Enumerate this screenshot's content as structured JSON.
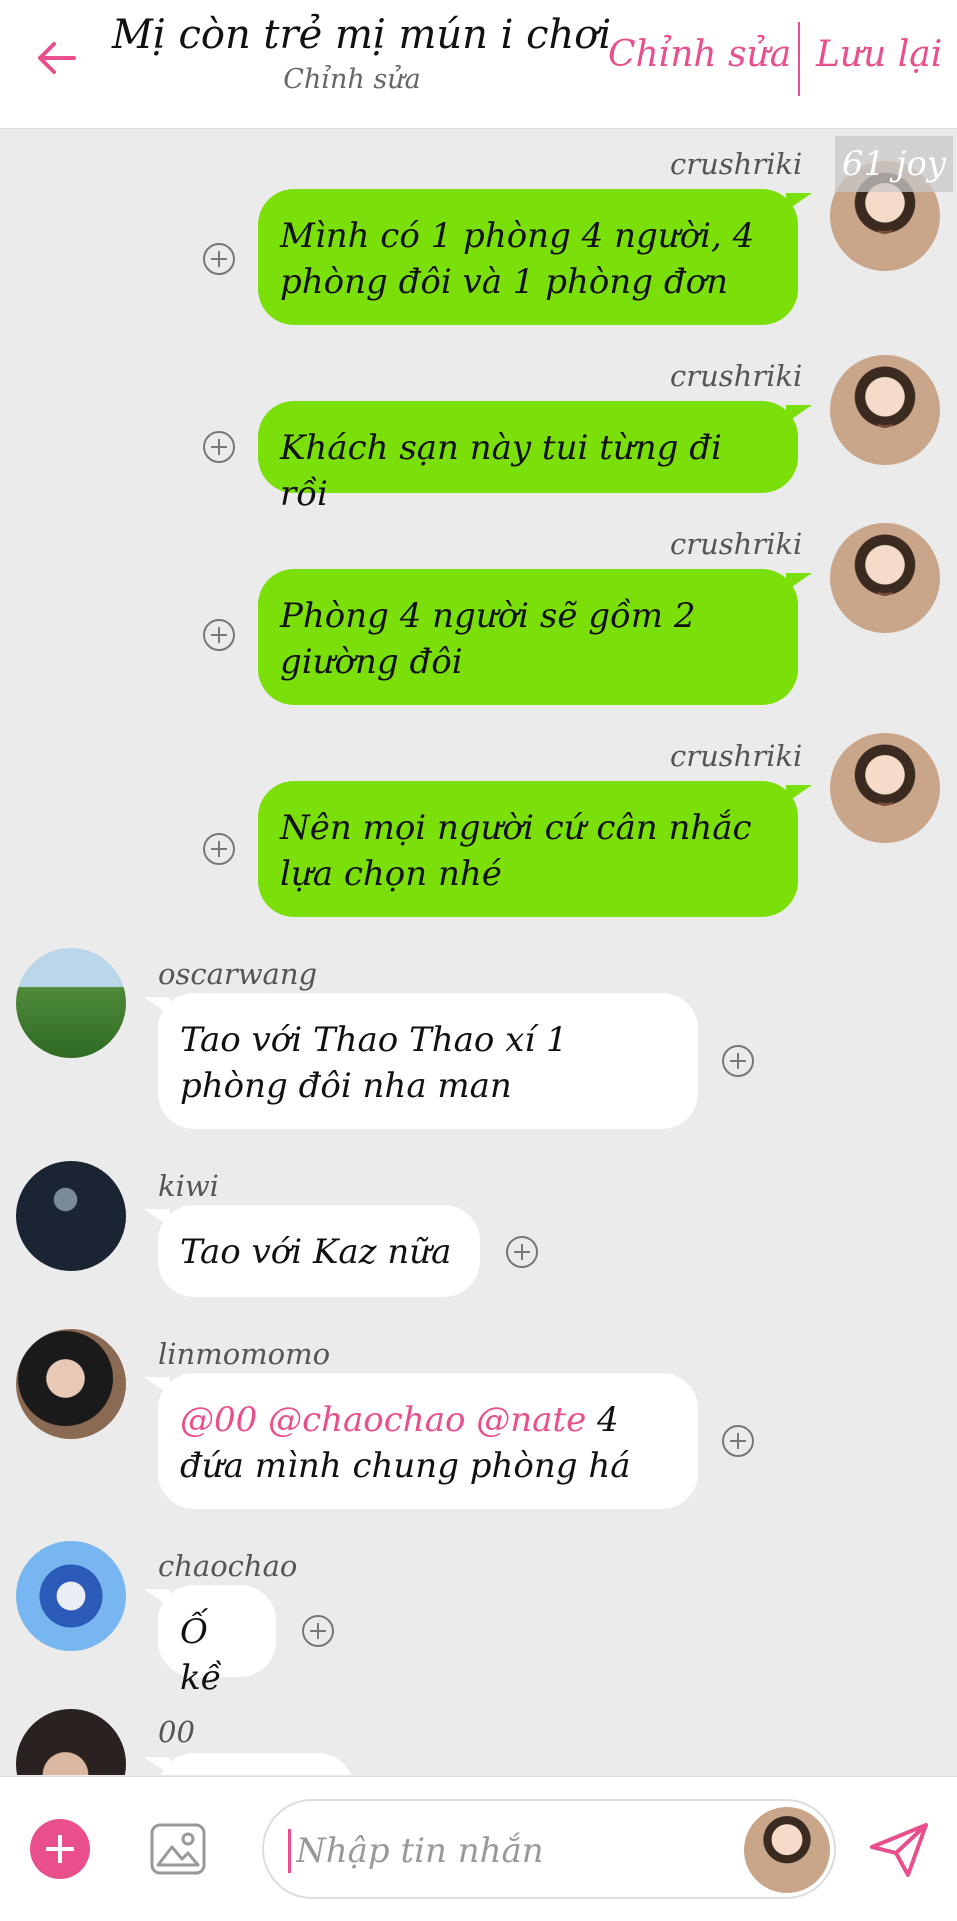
{
  "header": {
    "title": "Mị còn trẻ mị mún i chơi",
    "subtitle": "Chỉnh sửa",
    "edit_label": "Chỉnh sửa",
    "save_label": "Lưu lại"
  },
  "watermark": "61 joy",
  "messages": [
    {
      "username": "crushriki",
      "text": "Mình có 1 phòng 4 người, 4 phòng đôi và 1 phòng đơn"
    },
    {
      "username": "crushriki",
      "text": "Khách sạn này tui từng đi rồi"
    },
    {
      "username": "crushriki",
      "text": "Phòng 4 người sẽ gồm 2 giường đôi"
    },
    {
      "username": "crushriki",
      "text": "Nên mọi người cứ cân nhắc lựa chọn nhé"
    },
    {
      "username": "oscarwang",
      "text": "Tao với Thao Thao xí 1 phòng đôi nha man"
    },
    {
      "username": "kiwi",
      "text": "Tao với Kaz nữa"
    },
    {
      "username": "linmomomo",
      "mentions": "@00 @chaochao @nate",
      "text": " 4 đứa mình chung phòng há"
    },
    {
      "username": "chaochao",
      "text": "Ố kề"
    },
    {
      "username": "00",
      "text": ""
    }
  ],
  "composer": {
    "placeholder": "Nhập tin nhắn"
  },
  "colors": {
    "accent": "#e94f8c",
    "own_bubble": "#7be00a",
    "other_bubble": "#ffffff",
    "background": "#ebebeb"
  },
  "icons": [
    "back-arrow-icon",
    "plus-circle-icon",
    "add-icon",
    "image-icon",
    "send-icon"
  ]
}
